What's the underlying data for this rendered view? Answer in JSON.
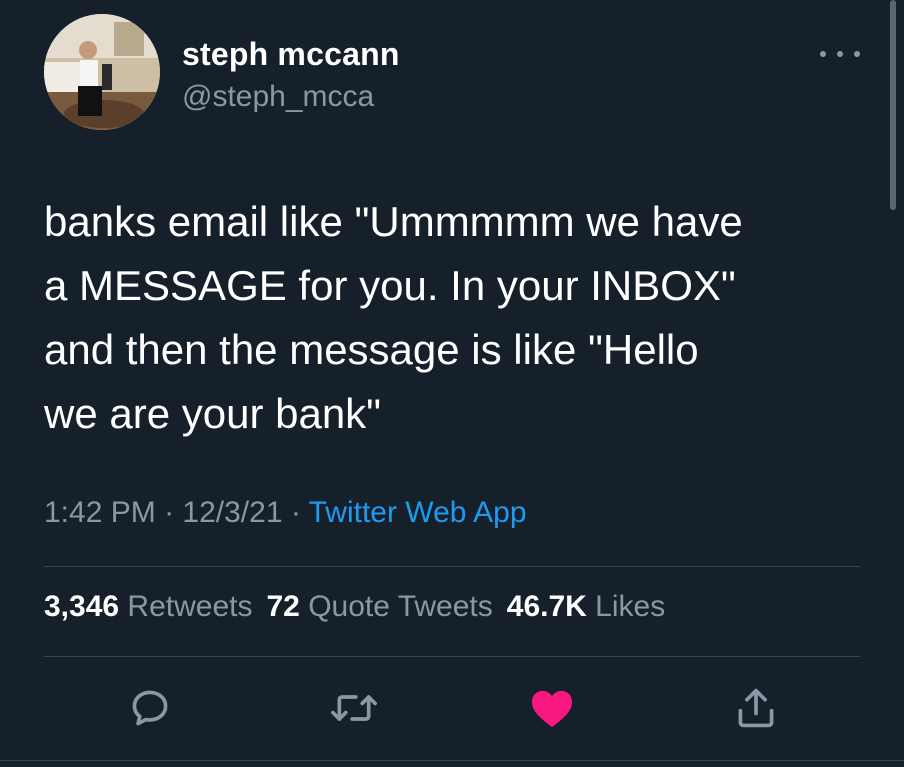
{
  "user": {
    "display_name": "steph mccann",
    "handle": "@steph_mcca"
  },
  "tweet": {
    "text": "banks email like \"Ummmmm we have\na MESSAGE for you. In your INBOX\"\nand then the message is like \"Hello\nwe are your bank\"",
    "time": "1:42 PM",
    "separator": " · ",
    "date": "12/3/21",
    "source": "Twitter Web App"
  },
  "stats": {
    "retweets_count": "3,346",
    "retweets_label": "Retweets",
    "quote_count": "72",
    "quote_label": "Quote Tweets",
    "likes_count": "46.7K",
    "likes_label": "Likes"
  },
  "actions": {
    "reply_icon": "reply-icon",
    "retweet_icon": "retweet-icon",
    "like_icon": "heart-icon",
    "share_icon": "share-icon"
  },
  "colors": {
    "background": "#15202b",
    "secondary_text": "#8899a6",
    "link": "#1d9bf0",
    "like": "#f91880",
    "divider": "#38444d"
  }
}
